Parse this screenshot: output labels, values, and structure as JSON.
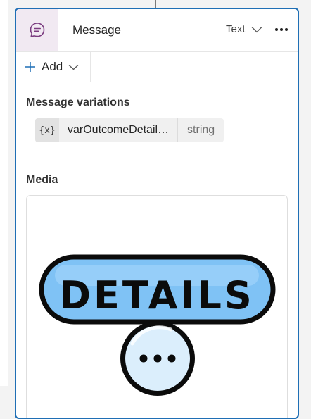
{
  "card": {
    "title": "Message",
    "type_select_label": "Text",
    "more_label": "…"
  },
  "toolbar": {
    "add_label": "Add"
  },
  "variations": {
    "label": "Message variations",
    "variable": {
      "icon_text": "{x}",
      "name": "varOutcomeDetail…",
      "type": "string"
    }
  },
  "media": {
    "label": "Media",
    "image_text": "DETAILS"
  },
  "colors": {
    "accent_border": "#1f6fb5",
    "header_icon_bg": "#f1e9f2",
    "icon_purple": "#7a3b7f",
    "sticker_fill": "#7fc2f5",
    "sticker_outline": "#0b0b0b"
  },
  "icons": {
    "header": "chat-bubble-icon",
    "add": "plus-icon",
    "dropdown": "chevron-down-icon",
    "more": "more-horizontal-icon"
  }
}
